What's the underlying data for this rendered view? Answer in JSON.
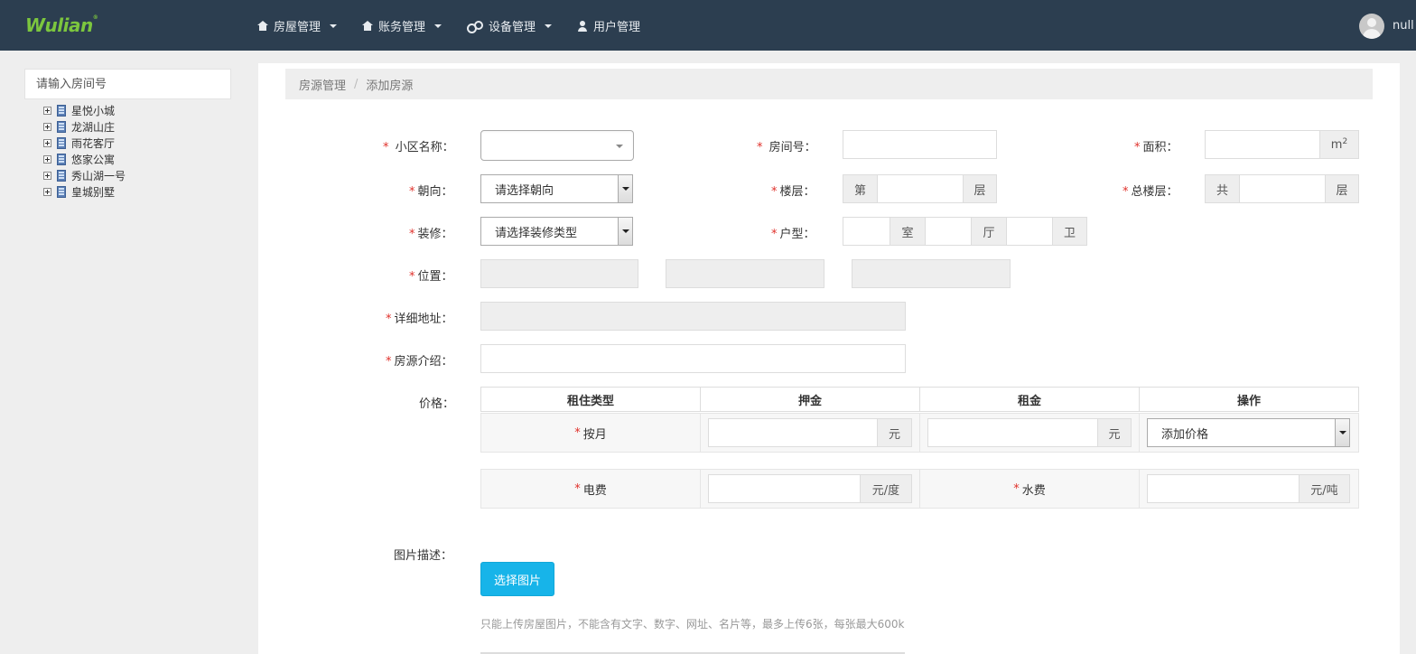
{
  "header": {
    "logo_text": "Wulian",
    "logo_mark": "®",
    "nav": [
      {
        "label": "房屋管理",
        "icon": "home-icon",
        "has_dropdown": true
      },
      {
        "label": "账务管理",
        "icon": "home-icon",
        "has_dropdown": true
      },
      {
        "label": "设备管理",
        "icon": "cogs-icon",
        "has_dropdown": true
      },
      {
        "label": "用户管理",
        "icon": "user-icon",
        "has_dropdown": false
      }
    ],
    "username": "null"
  },
  "sidebar": {
    "search_placeholder": "请输入房间号",
    "tree": [
      {
        "label": "星悦小城"
      },
      {
        "label": "龙湖山庄"
      },
      {
        "label": "雨花客厅"
      },
      {
        "label": "悠家公寓"
      },
      {
        "label": "秀山湖一号"
      },
      {
        "label": "皇城别墅"
      }
    ]
  },
  "breadcrumb": {
    "items": [
      "房源管理",
      "添加房源"
    ],
    "separator": "/"
  },
  "form": {
    "required_mark": "*",
    "community": {
      "label": "小区名称：",
      "value": ""
    },
    "room_no": {
      "label": "房间号：",
      "value": ""
    },
    "area": {
      "label": "面积：",
      "unit": "m",
      "unit_sup": "2",
      "value": ""
    },
    "orientation": {
      "label": "朝向：",
      "selected": "请选择朝向"
    },
    "floor": {
      "label": "楼层：",
      "prefix": "第",
      "suffix": "层",
      "value": ""
    },
    "total_floors": {
      "label": "总楼层：",
      "prefix": "共",
      "suffix": "层",
      "value": ""
    },
    "decoration": {
      "label": "装修：",
      "selected": "请选择装修类型"
    },
    "layout": {
      "label": "户型：",
      "room": "室",
      "hall": "厅",
      "bath": "卫"
    },
    "location": {
      "label": "位置："
    },
    "address": {
      "label": "详细地址："
    },
    "intro": {
      "label": "房源介绍："
    },
    "price": {
      "label": "价格：",
      "headers": [
        "租住类型",
        "押金",
        "租金",
        "操作"
      ],
      "monthly": {
        "type": "按月",
        "deposit_unit": "元",
        "rent_unit": "元",
        "action_selected": "添加价格"
      },
      "electricity": {
        "label": "电费",
        "unit": "元/度"
      },
      "water": {
        "label": "水费",
        "unit": "元/吨"
      }
    },
    "images": {
      "label": "图片描述：",
      "button": "选择图片",
      "hint": "只能上传房屋图片，不能含有文字、数字、网址、名片等，最多上传6张，每张最大600k"
    }
  },
  "colors": {
    "navbar": "#2c3e50",
    "logo": "#7cc63e",
    "accent": "#17b4e9",
    "required": "#e0302a"
  }
}
